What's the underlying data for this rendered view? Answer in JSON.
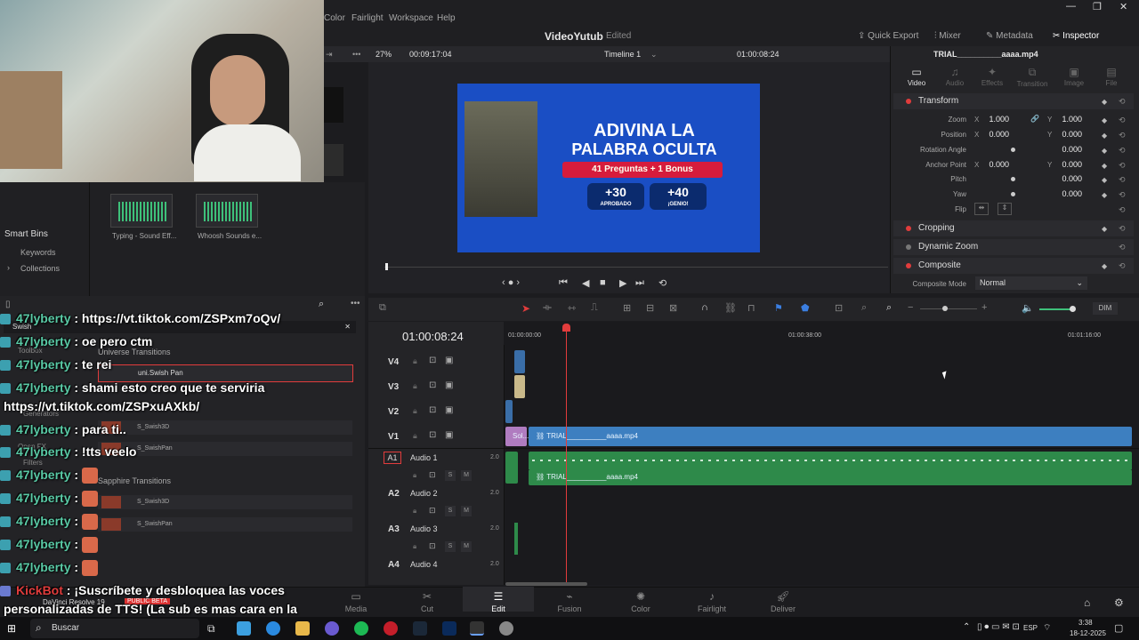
{
  "menu": {
    "items": [
      "Color",
      "Fairlight",
      "Workspace",
      "Help"
    ],
    "window_controls": [
      "—",
      "❐",
      "✕"
    ]
  },
  "header": {
    "project_title": "VideoYutub",
    "project_state": "Edited",
    "buttons": {
      "quick_export": "Quick Export",
      "mixer": "Mixer",
      "metadata": "Metadata",
      "inspector": "Inspector"
    }
  },
  "viewer": {
    "zoom": "27%",
    "source_timecode": "00:09:17:04",
    "timeline_name": "Timeline 1",
    "record_timecode": "01:00:08:24",
    "frame": {
      "title_line1": "ADIVINA LA",
      "title_line2": "PALABRA OCULTA",
      "subtitle": "41 Preguntas + 1 Bonus",
      "button1_value": "+30",
      "button1_label": "APROBADO",
      "button2_value": "+40",
      "button2_label": "¡GENIO!"
    }
  },
  "inspector": {
    "clip_name": "TRIAL__________aaaa.mp4",
    "tabs": [
      "Video",
      "Audio",
      "Effects",
      "Transition",
      "Image",
      "File"
    ],
    "active_tab": "Video",
    "transform": {
      "label": "Transform",
      "zoom_label": "Zoom",
      "zoom_x": "1.000",
      "zoom_y": "1.000",
      "position_label": "Position",
      "position_x": "0.000",
      "position_y": "0.000",
      "rotation_label": "Rotation Angle",
      "rotation": "0.000",
      "anchor_label": "Anchor Point",
      "anchor_x": "0.000",
      "anchor_y": "0.000",
      "pitch_label": "Pitch",
      "pitch": "0.000",
      "yaw_label": "Yaw",
      "yaw": "0.000",
      "flip_label": "Flip"
    },
    "cropping": "Cropping",
    "dynamic_zoom": "Dynamic Zoom",
    "composite": "Composite",
    "composite_mode_label": "Composite Mode",
    "composite_mode_value": "Normal"
  },
  "media_pool": {
    "smart_bins": "Smart Bins",
    "keywords": "Keywords",
    "collections": "Collections",
    "clips": [
      {
        "name": "Typing - Sound Eff..."
      },
      {
        "name": "Whoosh Sounds e..."
      }
    ]
  },
  "effects": {
    "search_value": "Swish",
    "toolbox": "Toolbox",
    "universe_transitions": "Universe Transitions",
    "selected_item": "uni.Swish Pan",
    "sapphire_transitions": "Sapphire Transitions",
    "items": [
      "S_Swish3D",
      "S_SwishPan",
      "S_Swish3D",
      "S_SwishPan"
    ],
    "side_items": [
      "Generators",
      "Open FX",
      "Filters"
    ]
  },
  "timeline": {
    "timecode": "01:00:08:24",
    "ruler": [
      "01:00:00:00",
      "01:00:38:00",
      "01:01:16:00"
    ],
    "video_tracks": [
      "V4",
      "V3",
      "V2",
      "V1"
    ],
    "audio_tracks": [
      {
        "id": "A1",
        "name": "Audio 1",
        "level": "2.0"
      },
      {
        "id": "A2",
        "name": "Audio 2",
        "level": "2.0"
      },
      {
        "id": "A3",
        "name": "Audio 3",
        "level": "2.0"
      },
      {
        "id": "A4",
        "name": "Audio 4",
        "level": "2.0"
      }
    ],
    "video_clip": "TRIAL__________aaaa.mp4",
    "solid_clip": "Sol...",
    "audio_clip": "TRIAL__________aaaa.mp4",
    "dim_label": "DIM"
  },
  "pages": [
    "Media",
    "Cut",
    "Edit",
    "Fusion",
    "Color",
    "Fairlight",
    "Deliver"
  ],
  "active_page": "Edit",
  "chat": [
    {
      "user": "47lyberty",
      "text": ": https://vt.tiktok.com/ZSPxm7oQv/"
    },
    {
      "user": "47lyberty",
      "text": ": oe pero ctm"
    },
    {
      "user": "47lyberty",
      "text": ": te rei"
    },
    {
      "user": "47lyberty",
      "text": ": shami esto creo que te serviria"
    },
    {
      "user": "",
      "text": "https://vt.tiktok.com/ZSPxuAXkb/"
    },
    {
      "user": "47lyberty",
      "text": ": para ti.."
    },
    {
      "user": "47lyberty",
      "text": ": !tts veelo"
    },
    {
      "user": "47lyberty",
      "text": ":"
    },
    {
      "user": "47lyberty",
      "text": ":"
    },
    {
      "user": "47lyberty",
      "text": ":"
    },
    {
      "user": "47lyberty",
      "text": ":"
    },
    {
      "user": "47lyberty",
      "text": ":"
    },
    {
      "user": "47lyberty",
      "text": ":"
    }
  ],
  "bot_message": {
    "user": "KickBot",
    "line1": ": ¡Suscríbete y desbloquea las voces",
    "line2": "personalizadas de TTS! (La sub es mas cara en la"
  },
  "resolve_badge": "DaVinci Resolve 19",
  "resolve_beta": "PUBLIC BETA",
  "taskbar": {
    "search_placeholder": "Buscar",
    "language": "ESP",
    "time": "3:38",
    "date": "18-12-2025"
  },
  "colors": {
    "accent_red": "#e23c3c",
    "video_clip": "#3d7fc0",
    "audio_clip": "#2e8a4a",
    "chat_user": "#59c9a5"
  }
}
